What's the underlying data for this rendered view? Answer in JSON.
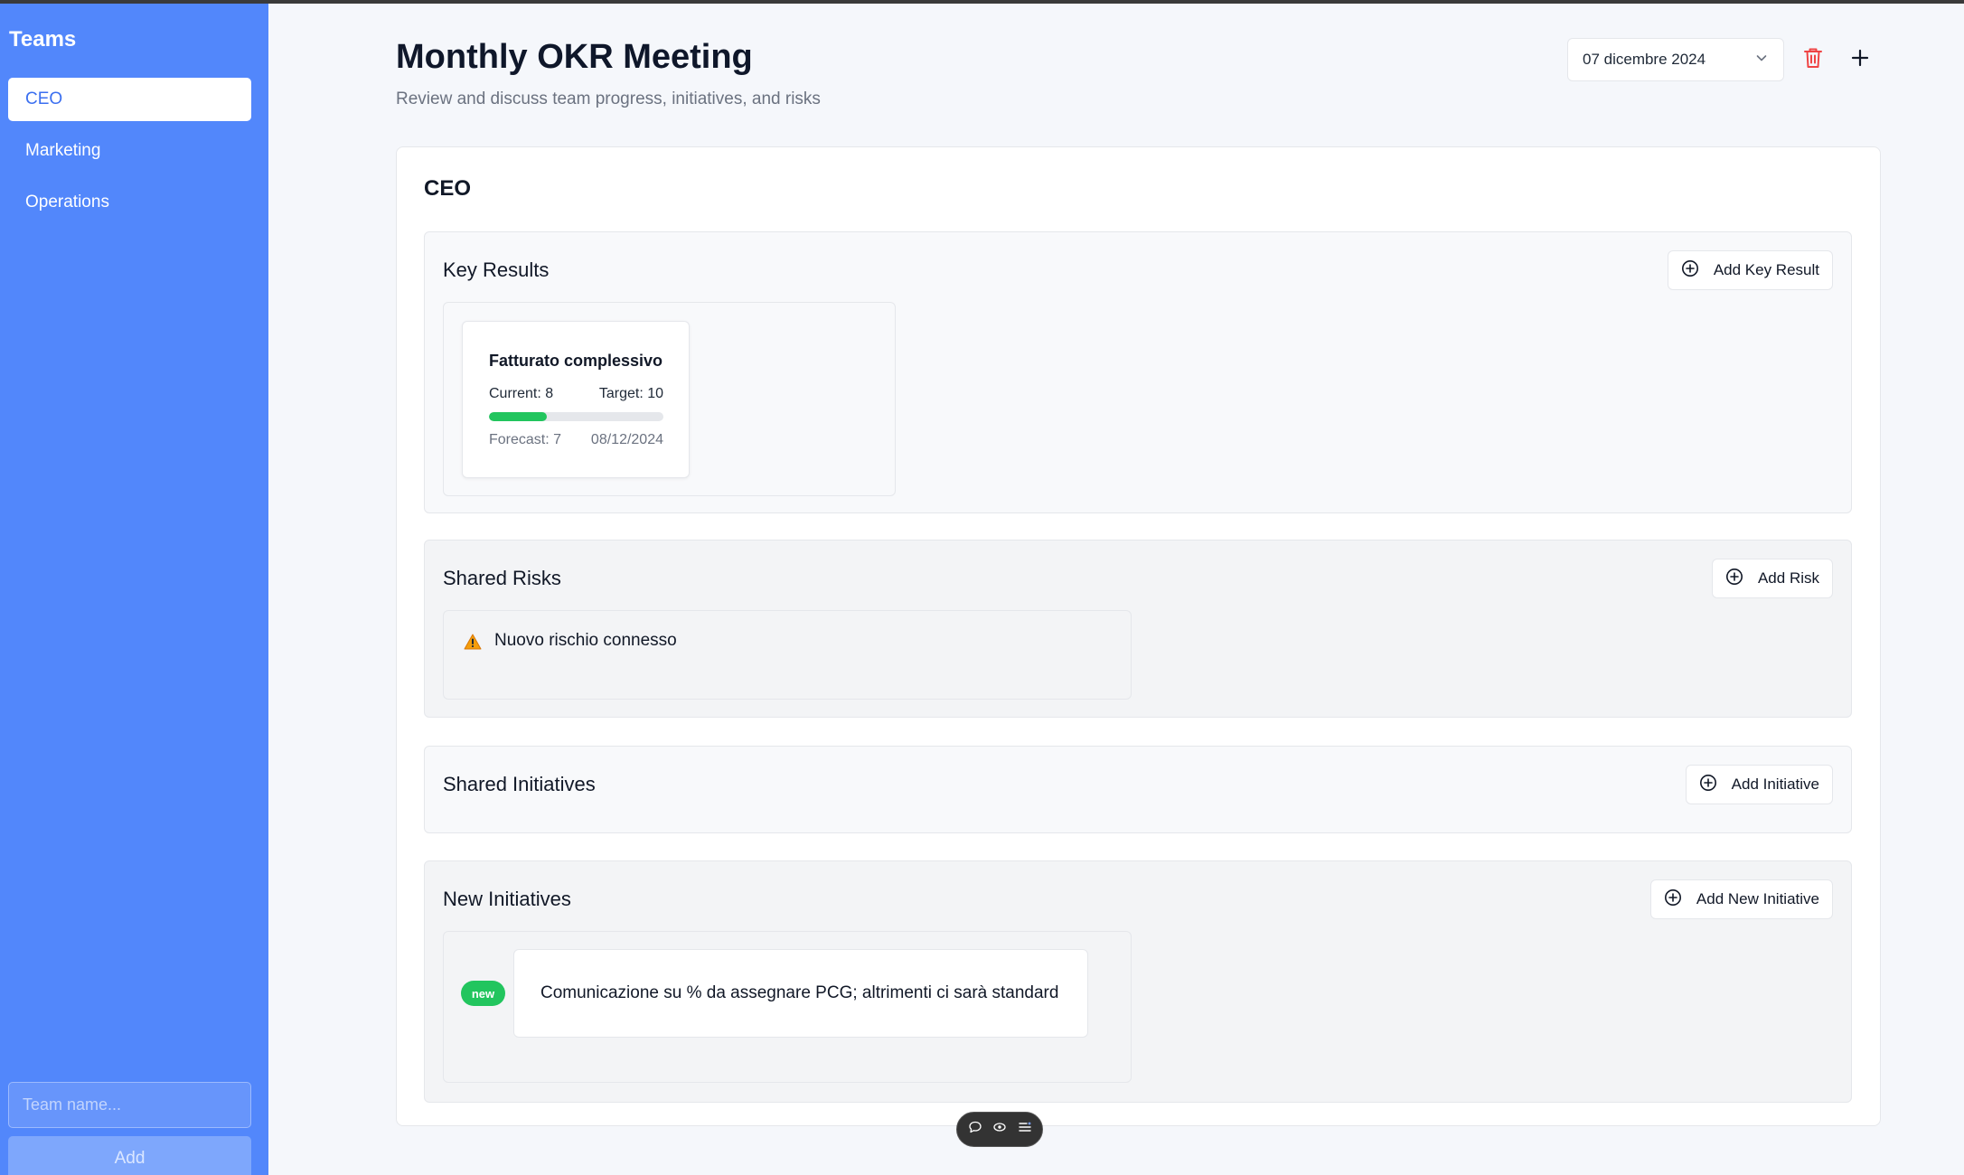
{
  "sidebar": {
    "title": "Teams",
    "teams": [
      {
        "label": "CEO",
        "active": true
      },
      {
        "label": "Marketing",
        "active": false
      },
      {
        "label": "Operations",
        "active": false
      }
    ],
    "team_input_placeholder": "Team name...",
    "add_label": "Add"
  },
  "header": {
    "title": "Monthly OKR Meeting",
    "subtitle": "Review and discuss team progress, initiatives, and risks",
    "date_value": "07 dicembre 2024",
    "icons": {
      "date_dropdown": "chevron-down-icon",
      "delete": "trash-icon",
      "add": "plus-icon"
    },
    "delete_color": "#ef4444"
  },
  "team_card": {
    "title": "CEO",
    "key_results": {
      "title": "Key Results",
      "add_label": "Add Key Result",
      "items": [
        {
          "name": "Fatturato complessivo",
          "current_label": "Current: 8",
          "target_label": "Target: 10",
          "forecast_label": "Forecast: 7",
          "date": "08/12/2024",
          "progress_fraction": 0.33,
          "progress_color": "#22c55e"
        }
      ]
    },
    "shared_risks": {
      "title": "Shared Risks",
      "add_label": "Add Risk",
      "items": [
        {
          "icon": "warning-icon",
          "text": "Nuovo rischio connesso"
        }
      ]
    },
    "shared_initiatives": {
      "title": "Shared Initiatives",
      "add_label": "Add Initiative"
    },
    "new_initiatives": {
      "title": "New Initiatives",
      "add_label": "Add New Initiative",
      "items": [
        {
          "badge": "new",
          "text": "Comunicazione su % da assegnare PCG; altrimenti ci sarà standard"
        }
      ]
    }
  },
  "floating_toolbar": {
    "icons": [
      "comment-icon",
      "eye-icon",
      "list-icon"
    ]
  },
  "colors": {
    "sidebar_bg": "#5287fb",
    "accent": "#3b6ff0",
    "success": "#22c55e"
  }
}
